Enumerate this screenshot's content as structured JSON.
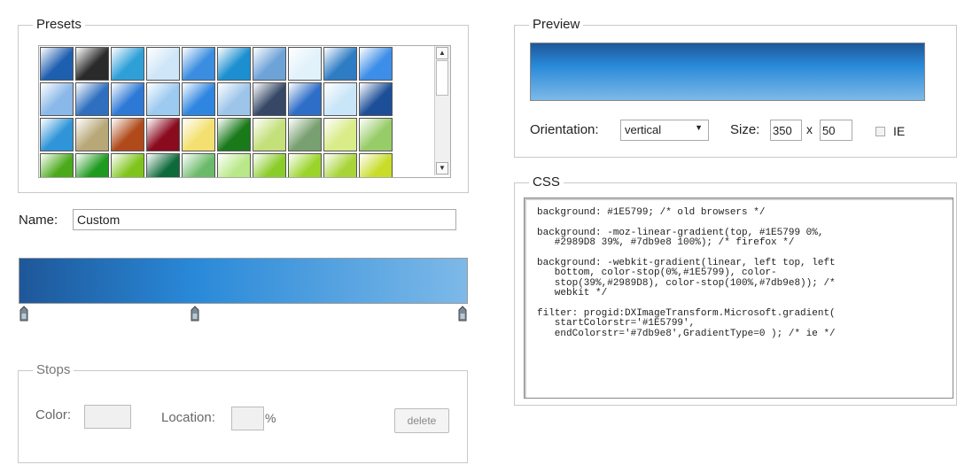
{
  "presets": {
    "legend": "Presets",
    "swatches": [
      [
        "#1f5fb0",
        "#2a2a2a",
        "#2f9fd8",
        "#cfe6f8",
        "#3a8de0",
        "#1c8fd0",
        "#6ea3d8",
        "#e2f2fb",
        "#2d7cc4",
        "#3d8ee8"
      ],
      [
        "#8ab8e8",
        "#2e6fbf",
        "#2d79d6",
        "#9ccaf0",
        "#2f86e0",
        "#9dc5ea",
        "#364866",
        "#2e6ec8",
        "#c9e6f8",
        "#1d4f98"
      ],
      [
        "#2f94d8",
        "#b8a878",
        "#b04a1a",
        "#8a0a1e",
        "#f4e070",
        "#1a7a1a",
        "#c4e07a",
        "#78a070",
        "#d8ec88",
        "#98cc68"
      ],
      [
        "#4aaa1a",
        "#1e9a1e",
        "#7ec41a",
        "#0e6a3a",
        "#6aba6a",
        "#b8e888",
        "#8acc2a",
        "#9ad42a",
        "#a8d438",
        "#c8dc28"
      ]
    ],
    "scrollbar": {
      "up_icon": "▲",
      "down_icon": "▼"
    }
  },
  "name": {
    "label": "Name:",
    "value": "Custom"
  },
  "gradient": {
    "colors": [
      "#1e5799",
      "#2989d8",
      "#7db9e8"
    ],
    "stop_locations_percent": [
      0,
      39,
      100
    ]
  },
  "stops": {
    "legend": "Stops",
    "color_label": "Color:",
    "location_label": "Location:",
    "percent_label": "%",
    "delete_label": "delete"
  },
  "preview": {
    "legend": "Preview",
    "orientation_label": "Orientation:",
    "orientation_value": "vertical",
    "size_label": "Size:",
    "width_value": "350",
    "x_label": "x",
    "height_value": "50",
    "ie_label": "IE"
  },
  "css": {
    "legend": "CSS",
    "lines": [
      "background: #1E5799; /* old browsers */",
      "background: -moz-linear-gradient(top, #1E5799 0%,\n   #2989D8 39%, #7db9e8 100%); /* firefox */",
      "background: -webkit-gradient(linear, left top, left\n   bottom, color-stop(0%,#1E5799), color-\n   stop(39%,#2989D8), color-stop(100%,#7db9e8)); /*\n   webkit */",
      "filter: progid:DXImageTransform.Microsoft.gradient(\n   startColorstr='#1E5799',\n   endColorstr='#7db9e8',GradientType=0 ); /* ie */"
    ]
  }
}
